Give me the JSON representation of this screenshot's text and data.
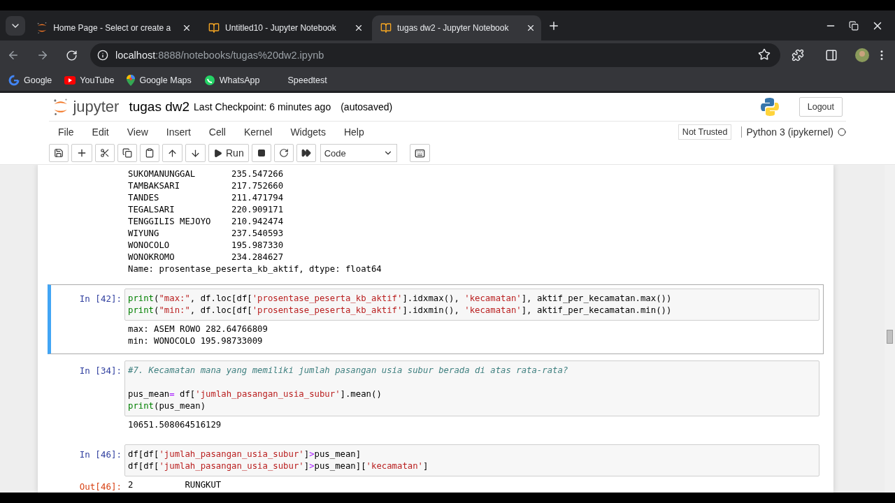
{
  "browser": {
    "tabs": [
      {
        "title": "Home Page - Select or create a",
        "selected": false
      },
      {
        "title": "Untitled10 - Jupyter Notebook",
        "selected": false
      },
      {
        "title": "tugas dw2 - Jupyter Notebook",
        "selected": true
      }
    ],
    "url_host": "localhost",
    "url_rest": ":8888/notebooks/tugas%20dw2.ipynb",
    "bookmarks": [
      "Google",
      "YouTube",
      "Google Maps",
      "WhatsApp",
      "Speedtest"
    ]
  },
  "jupyter": {
    "logo_text": "jupyter",
    "notebook_name": "tugas dw2",
    "checkpoint": "Last Checkpoint: 6 minutes ago",
    "autosave": "(autosaved)",
    "logout": "Logout",
    "menu": [
      "File",
      "Edit",
      "View",
      "Insert",
      "Cell",
      "Kernel",
      "Widgets",
      "Help"
    ],
    "trust": "Not Trusted",
    "kernel": "Python 3 (ipykernel)",
    "run": "Run",
    "cell_type": "Code"
  },
  "cells": [
    {
      "selected": false,
      "output": [
        "SUKOMANUNGGAL       235.547266",
        "TAMBAKSARI          217.752660",
        "TANDES              211.471794",
        "TEGALSARI           220.909171",
        "TENGGILIS MEJOYO    210.942474",
        "WIYUNG              237.540593",
        "WONOCOLO            195.987330",
        "WONOKROMO           234.284627",
        "Name: prosentase_peserta_kb_aktif, dtype: float64"
      ]
    },
    {
      "prompt_in": "In [42]:",
      "selected": true,
      "code": [
        {
          "tokens": [
            {
              "kind": "builtin",
              "text": "print"
            },
            {
              "kind": "plain",
              "text": "("
            },
            {
              "kind": "string",
              "text": "\"max:\""
            },
            {
              "kind": "plain",
              "text": ", df.loc[df["
            },
            {
              "kind": "string",
              "text": "'prosentase_peserta_kb_aktif'"
            },
            {
              "kind": "plain",
              "text": "].idxmax(), "
            },
            {
              "kind": "string",
              "text": "'kecamatan'"
            },
            {
              "kind": "plain",
              "text": "], aktif_per_kecamatan.max())"
            }
          ]
        },
        {
          "tokens": [
            {
              "kind": "builtin",
              "text": "print"
            },
            {
              "kind": "plain",
              "text": "("
            },
            {
              "kind": "string",
              "text": "\"min:\""
            },
            {
              "kind": "plain",
              "text": ", df.loc[df["
            },
            {
              "kind": "string",
              "text": "'prosentase_peserta_kb_aktif'"
            },
            {
              "kind": "plain",
              "text": "].idxmin(), "
            },
            {
              "kind": "string",
              "text": "'kecamatan'"
            },
            {
              "kind": "plain",
              "text": "], aktif_per_kecamatan.min())"
            }
          ]
        }
      ],
      "output": [
        "max: ASEM ROWO 282.64766809",
        "min: WONOCOLO 195.98733009"
      ]
    },
    {
      "prompt_in": "In [34]:",
      "selected": false,
      "code": [
        {
          "tokens": [
            {
              "kind": "comment",
              "text": "#7. Kecamatan mana yang memiliki jumlah pasangan usia subur berada di atas rata-rata?"
            }
          ]
        },
        {
          "gap_before": true,
          "tokens": [
            {
              "kind": "plain",
              "text": "pus_mean"
            },
            {
              "kind": "op",
              "text": "="
            },
            {
              "kind": "plain",
              "text": " df["
            },
            {
              "kind": "string",
              "text": "'jumlah_pasangan_usia_subur'"
            },
            {
              "kind": "plain",
              "text": "].mean()"
            }
          ]
        },
        {
          "tokens": [
            {
              "kind": "builtin",
              "text": "print"
            },
            {
              "kind": "plain",
              "text": "(pus_mean)"
            }
          ]
        }
      ],
      "output": [
        "10651.508064516129"
      ]
    },
    {
      "prompt_in": "In [46]:",
      "selected": false,
      "prompt_out": "Out[46]:",
      "code": [
        {
          "tokens": [
            {
              "kind": "plain",
              "text": "df[df["
            },
            {
              "kind": "string",
              "text": "'jumlah_pasangan_usia_subur'"
            },
            {
              "kind": "plain",
              "text": "]"
            },
            {
              "kind": "op",
              "text": ">"
            },
            {
              "kind": "plain",
              "text": "pus_mean]"
            }
          ]
        },
        {
          "tokens": [
            {
              "kind": "plain",
              "text": "df[df["
            },
            {
              "kind": "string",
              "text": "'jumlah_pasangan_usia_subur'"
            },
            {
              "kind": "plain",
              "text": "]"
            },
            {
              "kind": "op",
              "text": ">"
            },
            {
              "kind": "plain",
              "text": "pus_mean]["
            },
            {
              "kind": "string",
              "text": "'kecamatan'"
            },
            {
              "kind": "plain",
              "text": "]"
            }
          ]
        }
      ],
      "output": [
        "2          RUNGKUT"
      ]
    }
  ]
}
